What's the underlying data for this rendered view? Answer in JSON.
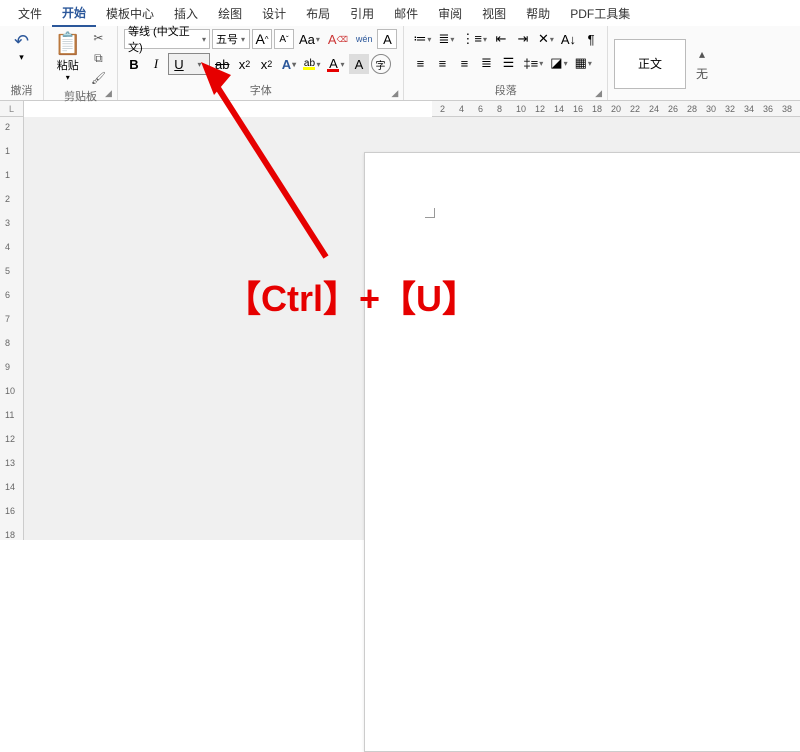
{
  "menu": {
    "file": "文件",
    "home": "开始",
    "template": "模板中心",
    "insert": "插入",
    "draw": "绘图",
    "design": "设计",
    "layout": "布局",
    "references": "引用",
    "mailings": "邮件",
    "review": "审阅",
    "view": "视图",
    "help": "帮助",
    "pdf": "PDF工具集"
  },
  "groups": {
    "undo": "撤消",
    "clipboard": "剪贴板",
    "font": "字体",
    "paragraph": "段落"
  },
  "clipboard": {
    "paste": "粘贴"
  },
  "font": {
    "name": "等线 (中文正文)",
    "size": "五号",
    "grow": "A",
    "shrink": "A",
    "changecase": "Aa",
    "clear": "A",
    "phonetic": "wén",
    "charborder": "A",
    "bold": "B",
    "italic": "I",
    "underline": "U",
    "strike": "ab",
    "sub": "x",
    "sub2": "2",
    "sup": "x",
    "sup2": "2",
    "texteffect": "A",
    "highlight": "ab",
    "fontcolor": "A",
    "charshade": "A",
    "enclose": "字"
  },
  "styles": {
    "normal": "正文",
    "more": "无"
  },
  "ruler": {
    "h": [
      "2",
      "4",
      "6",
      "8",
      "10",
      "12",
      "14",
      "16",
      "18",
      "20",
      "22",
      "24",
      "26",
      "28",
      "30",
      "32",
      "34",
      "36",
      "38"
    ],
    "v": [
      "2",
      "1",
      "1",
      "2",
      "3",
      "4",
      "5",
      "6",
      "7",
      "8",
      "9",
      "10",
      "11",
      "12",
      "13",
      "14",
      "16",
      "18"
    ]
  },
  "annotation": {
    "text": "【Ctrl】+【U】"
  }
}
